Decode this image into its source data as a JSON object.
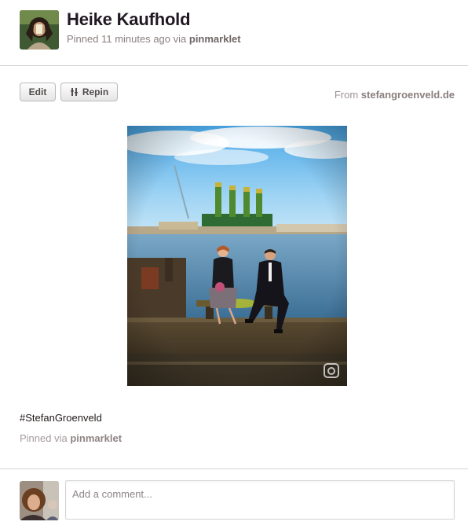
{
  "pin": {
    "user_name": "Heike Kaufhold",
    "pinned_prefix": "Pinned 11 minutes ago via ",
    "pinned_via_tool": "pinmarklet",
    "edit_label": "Edit",
    "repin_label": "Repin",
    "source_prefix": "From ",
    "source_domain": "stefangroenveld.de",
    "photo_icon": "camera-watermark-icon",
    "description": "#StefanGroenveld",
    "pinned_via_prefix": "Pinned via ",
    "pinned_via_source": "pinmarklet"
  },
  "comment": {
    "placeholder": "Add a comment..."
  },
  "colors": {
    "text": "#221919",
    "muted": "#8c7e7e",
    "sky": "#7fc3ee",
    "water": "#5b8bb0",
    "crane": "#3e7d35"
  }
}
